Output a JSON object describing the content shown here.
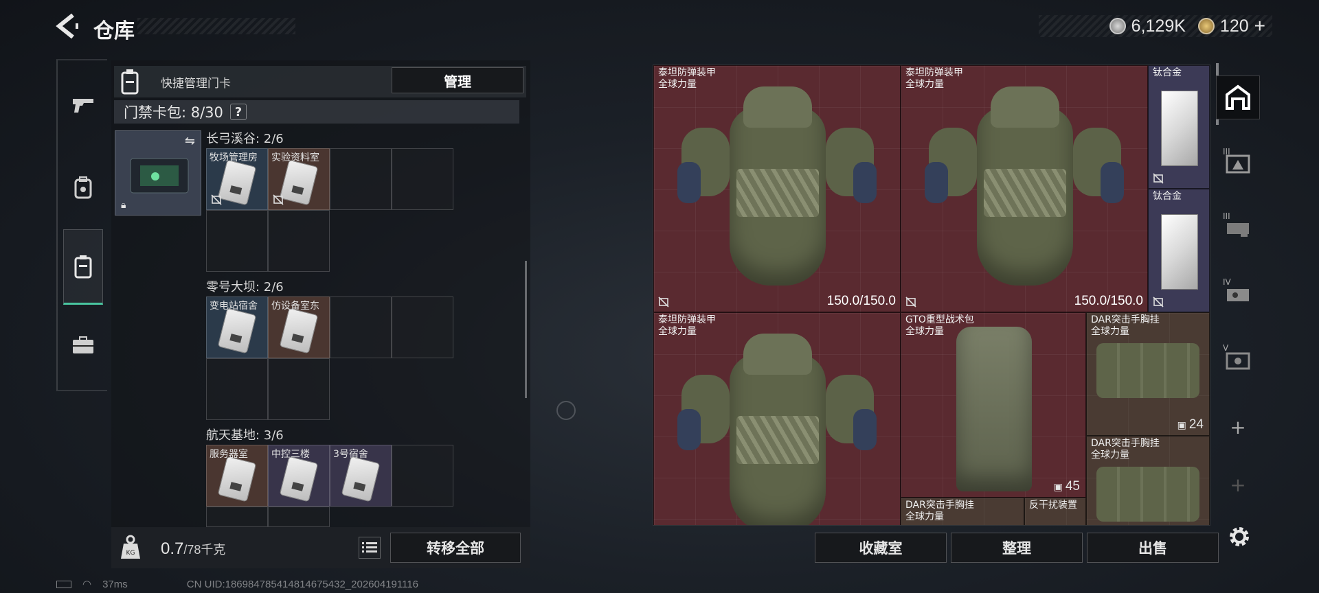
{
  "header": {
    "title": "仓库",
    "currency_main": "6,129K",
    "currency_secondary": "120",
    "add_symbol": "+"
  },
  "keycard_panel": {
    "quick_label": "快捷管理门卡",
    "manage_label": "管理",
    "cardbag_label": "门禁卡包: 8/30",
    "help_label": "?",
    "zones": [
      {
        "title": "长弓溪谷: 2/6",
        "cards": [
          {
            "label": "牧场管理房",
            "color": "blue"
          },
          {
            "label": "实验资料室",
            "color": "brown"
          }
        ]
      },
      {
        "title": "零号大坝: 2/6",
        "cards": [
          {
            "label": "变电站宿舍",
            "color": "blue"
          },
          {
            "label": "仿设备室东",
            "color": "brown"
          }
        ]
      },
      {
        "title": "航天基地: 3/6",
        "cards": [
          {
            "label": "服务器室",
            "color": "brown"
          },
          {
            "label": "中控三楼",
            "color": "purple"
          },
          {
            "label": "3号宿舍",
            "color": "purple"
          }
        ]
      }
    ],
    "weight_value": "0.7",
    "weight_capacity": "/78千克",
    "transfer_label": "转移全部"
  },
  "storage": {
    "items": [
      {
        "name": "泰坦防弹装甲",
        "tag": "全球力量",
        "value": "150.0/150.0",
        "color": "red"
      },
      {
        "name": "泰坦防弹装甲",
        "tag": "全球力量",
        "value": "150.0/150.0",
        "color": "red"
      },
      {
        "name": "钛合金",
        "tag": "",
        "value": "",
        "color": "purple"
      },
      {
        "name": "钛合金",
        "tag": "",
        "value": "",
        "color": "purple"
      },
      {
        "name": "泰坦防弹装甲",
        "tag": "全球力量",
        "value": "",
        "color": "red"
      },
      {
        "name": "GTO重型战术包",
        "tag": "全球力量",
        "badge": "45",
        "color": "red"
      },
      {
        "name": "DAR突击手胸挂",
        "tag": "全球力量",
        "badge": "24",
        "color": "brown"
      },
      {
        "name": "DAR突击手胸挂",
        "tag": "全球力量",
        "value": "",
        "color": "brown"
      },
      {
        "name": "DAR突击手胸挂",
        "tag": "全球力量",
        "value": "",
        "color": "brown"
      },
      {
        "name": "反干扰装置",
        "tag": "",
        "value": "",
        "color": "brown"
      }
    ]
  },
  "actions": {
    "collection_label": "收藏室",
    "sort_label": "整理",
    "sell_label": "出售"
  },
  "right_nav": {
    "tiers": [
      "III",
      "III",
      "IV",
      "V"
    ],
    "add": "+"
  },
  "status": {
    "ping": "37ms",
    "uid": "CN UID:18698478541481467543​2_202604191116"
  },
  "colors": {
    "accent_green": "#49c6a0",
    "item_red": "#5a2a30",
    "item_purple": "#3c3a56",
    "item_brown": "#4a3b33"
  }
}
